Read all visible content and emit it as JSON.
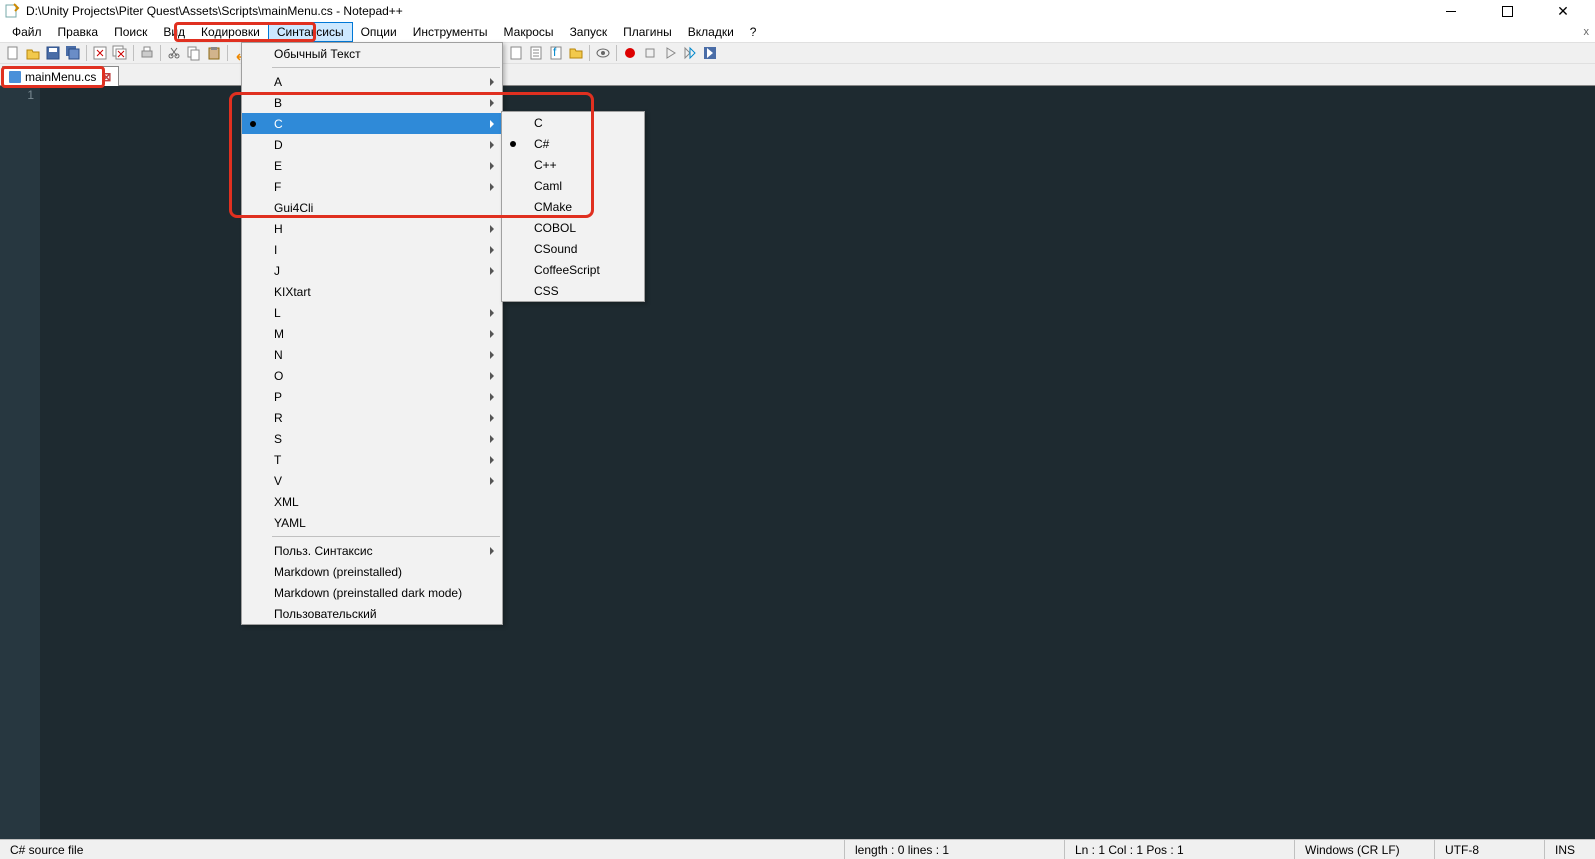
{
  "title": "D:\\Unity Projects\\Piter Quest\\Assets\\Scripts\\mainMenu.cs - Notepad++",
  "menubar": [
    "Файл",
    "Правка",
    "Поиск",
    "Вид",
    "Кодировки",
    "Синтаксисы",
    "Опции",
    "Инструменты",
    "Макросы",
    "Запуск",
    "Плагины",
    "Вкладки",
    "?"
  ],
  "menubar_selected_index": 5,
  "tab": {
    "name": "mainMenu.cs"
  },
  "gutter_line": "1",
  "syntax_menu": {
    "top": "Обычный Текст",
    "letters": [
      "A",
      "B",
      "C",
      "D",
      "E",
      "F",
      "Gui4Cli",
      "H",
      "I",
      "J",
      "KIXtart",
      "L",
      "M",
      "N",
      "O",
      "P",
      "R",
      "S",
      "T",
      "V",
      "XML",
      "YAML"
    ],
    "has_sub_flags": [
      true,
      true,
      true,
      true,
      true,
      true,
      false,
      true,
      true,
      true,
      false,
      true,
      true,
      true,
      true,
      true,
      true,
      true,
      true,
      true,
      false,
      false
    ],
    "highlighted_letter": "C",
    "bottom": [
      "Польз. Синтаксис",
      "Markdown (preinstalled)",
      "Markdown (preinstalled dark mode)",
      "Пользовательский"
    ],
    "bottom_has_sub": [
      true,
      false,
      false,
      false
    ]
  },
  "c_submenu": {
    "items": [
      "C",
      "C#",
      "C++",
      "Caml",
      "CMake",
      "COBOL",
      "CSound",
      "CoffeeScript",
      "CSS"
    ],
    "checked": "C#"
  },
  "statusbar": {
    "filetype": "C# source file",
    "length": "length : 0     lines : 1",
    "pos": "Ln : 1    Col : 1    Pos : 1",
    "eol": "Windows (CR LF)",
    "enc": "UTF-8",
    "ins": "INS"
  }
}
